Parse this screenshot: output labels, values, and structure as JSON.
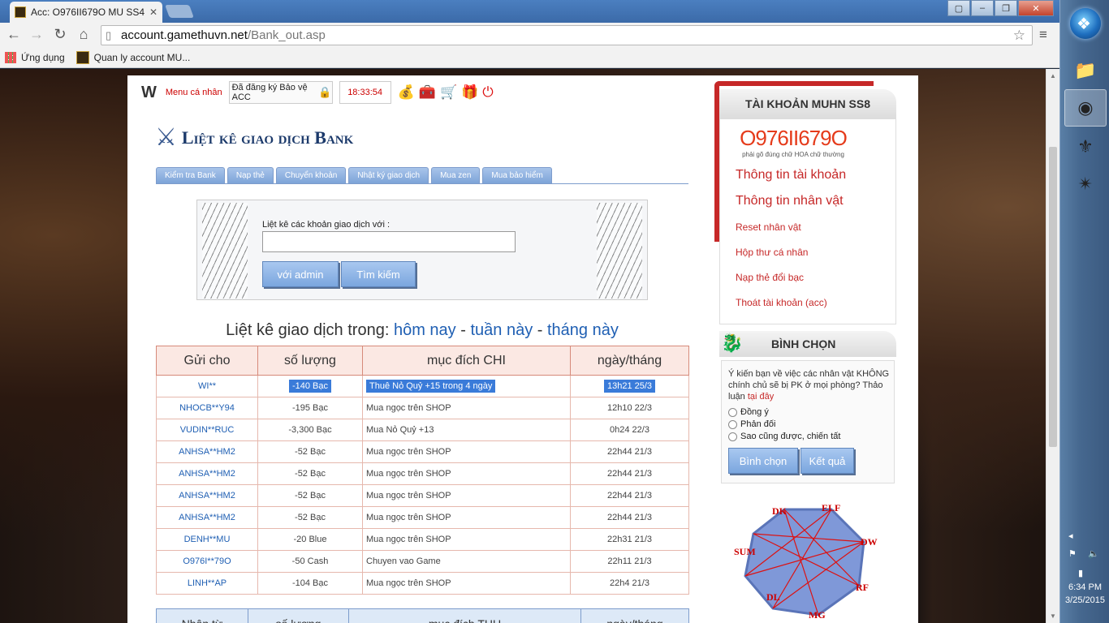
{
  "browser": {
    "tab_title": "Acc: O976II679O MU SS4",
    "url_host": "account.gamethuvn.net",
    "url_path": "/Bank_out.asp",
    "bookmarks": [
      {
        "label": "Ứng dụng"
      },
      {
        "label": "Quan ly account MU..."
      }
    ]
  },
  "topbar": {
    "menu_label": "Menu cá nhân",
    "register_status": "Đã đăng ký Bảo vệ ACC",
    "time": "18:33:54"
  },
  "main": {
    "heading": "Liệt kê giao dịch Bank",
    "tabs": [
      "Kiểm tra Bank",
      "Nạp thẻ",
      "Chuyển khoản",
      "Nhật ký giao dịch",
      "Mua zen",
      "Mua bảo hiểm"
    ],
    "search": {
      "label": "Liệt kê các khoản giao dịch với :",
      "input_value": "",
      "btn_admin": "với admin",
      "btn_search": "Tìm kiếm"
    },
    "list_title": {
      "prefix": "Liệt kê giao dịch trong:",
      "today": "hôm nay",
      "sep1": "-",
      "week": "tuần này",
      "sep2": "-",
      "month": "tháng này"
    },
    "table_out": {
      "headers": [
        "Gửi cho",
        "số lượng",
        "mục đích CHI",
        "ngày/tháng"
      ],
      "rows": [
        {
          "to": "WI**",
          "amount": "-140  Bạc",
          "purpose": "Thuê Nỏ Quỷ +15 trong 4 ngày",
          "date": "13h21 25/3"
        },
        {
          "to": "NHOCB**Y94",
          "amount": "-195  Bạc",
          "purpose": "Mua ngọc trên SHOP",
          "date": "12h10 22/3"
        },
        {
          "to": "VUDIN**RUC",
          "amount": "-3,300  Bạc",
          "purpose": "Mua Nỏ Quỷ +13",
          "date": "0h24 22/3"
        },
        {
          "to": "ANHSA**HM2",
          "amount": "-52  Bạc",
          "purpose": "Mua ngọc trên SHOP",
          "date": "22h44 21/3"
        },
        {
          "to": "ANHSA**HM2",
          "amount": "-52  Bạc",
          "purpose": "Mua ngọc trên SHOP",
          "date": "22h44 21/3"
        },
        {
          "to": "ANHSA**HM2",
          "amount": "-52  Bạc",
          "purpose": "Mua ngọc trên SHOP",
          "date": "22h44 21/3"
        },
        {
          "to": "ANHSA**HM2",
          "amount": "-52  Bạc",
          "purpose": "Mua ngọc trên SHOP",
          "date": "22h44 21/3"
        },
        {
          "to": "DENH**MU",
          "amount": "-20  Blue",
          "purpose": "Mua ngọc trên SHOP",
          "date": "22h31 21/3"
        },
        {
          "to": "O976I**79O",
          "amount": "-50  Cash",
          "purpose": "Chuyen vao Game",
          "date": "22h11 21/3"
        },
        {
          "to": "LINH**AP",
          "amount": "-104  Bạc",
          "purpose": "Mua ngọc trên SHOP",
          "date": "22h4 21/3"
        }
      ]
    },
    "table_in": {
      "headers": [
        "Nhận từ",
        "số lượng",
        "mục đích THU",
        "ngày/tháng"
      ]
    }
  },
  "account": {
    "header": "TÀI KHOẢN MUHN SS8",
    "number": "O976II679O",
    "note": "phải gõ đúng chữ HOA chữ thường",
    "links": [
      "Thông tin tài khoản",
      "Thông tin nhân vật",
      "Reset nhân vật",
      "Hộp thư cá nhân",
      "Nạp thẻ đổi bạc",
      "Thoát tài khoản (acc)"
    ]
  },
  "vote": {
    "header": "BÌNH CHỌN",
    "question": "Ý kiến bạn về việc các nhân vật KHÔNG chính chủ sẽ bị PK ở mọi phòng? Thảo luận",
    "here_link": "tại đây",
    "options": [
      "Đồng ý",
      "Phản đối",
      "Sao cũng được, chiến tất"
    ],
    "btn_vote": "Bình chọn",
    "btn_result": "Kết quả"
  },
  "diagram_labels": [
    "DK",
    "ELF",
    "DW",
    "RF",
    "MG",
    "DL",
    "SUM"
  ],
  "taskbar": {
    "time": "6:34 PM",
    "date": "3/25/2015"
  },
  "colors": {
    "accent_red": "#c62828",
    "link_blue": "#1f5fb3",
    "tab_blue": "#7da4d8"
  }
}
